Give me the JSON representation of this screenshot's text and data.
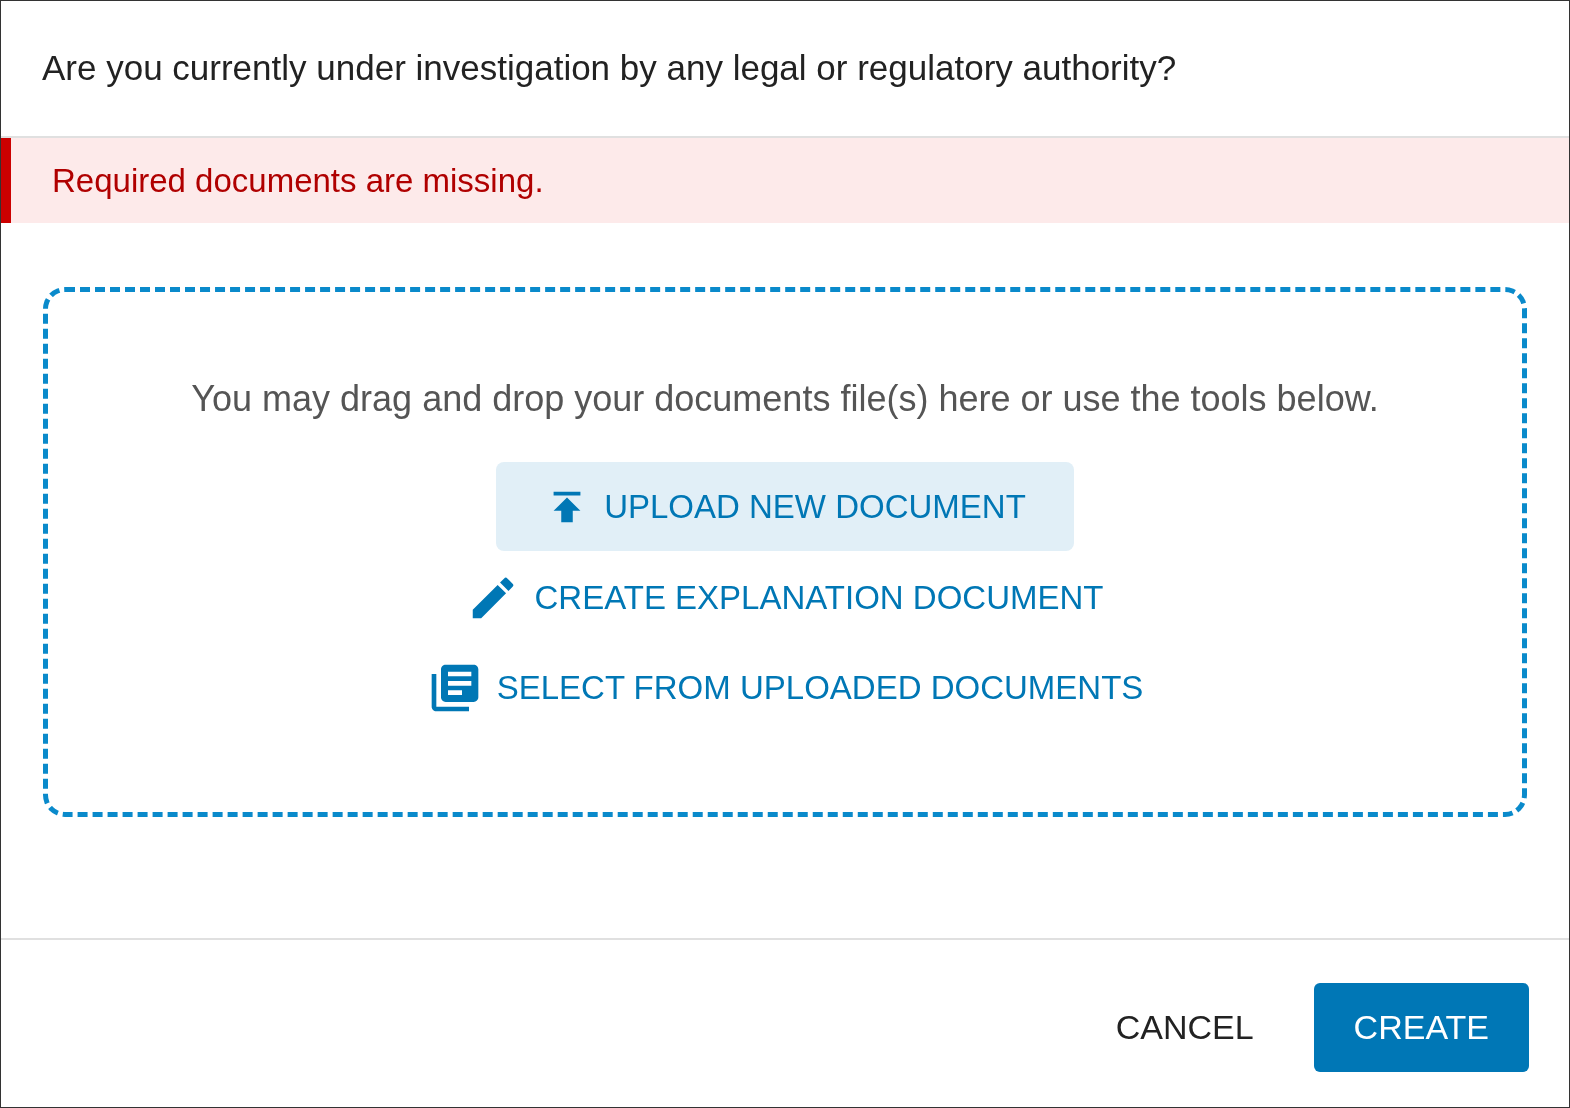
{
  "dialog": {
    "title": "Are you currently under investigation by any legal or regulatory authority?"
  },
  "alert": {
    "message": "Required documents are missing."
  },
  "dropzone": {
    "hint": "You may drag and drop your documents file(s) here or use the tools below.",
    "actions": [
      {
        "kind": "upload",
        "label": "UPLOAD NEW DOCUMENT"
      },
      {
        "kind": "edit",
        "label": "CREATE EXPLANATION DOCUMENT"
      },
      {
        "kind": "library",
        "label": "SELECT FROM UPLOADED DOCUMENTS"
      }
    ]
  },
  "footer": {
    "buttons": [
      {
        "kind": "text",
        "label": "CANCEL"
      },
      {
        "kind": "primary",
        "label": "CREATE"
      }
    ]
  }
}
